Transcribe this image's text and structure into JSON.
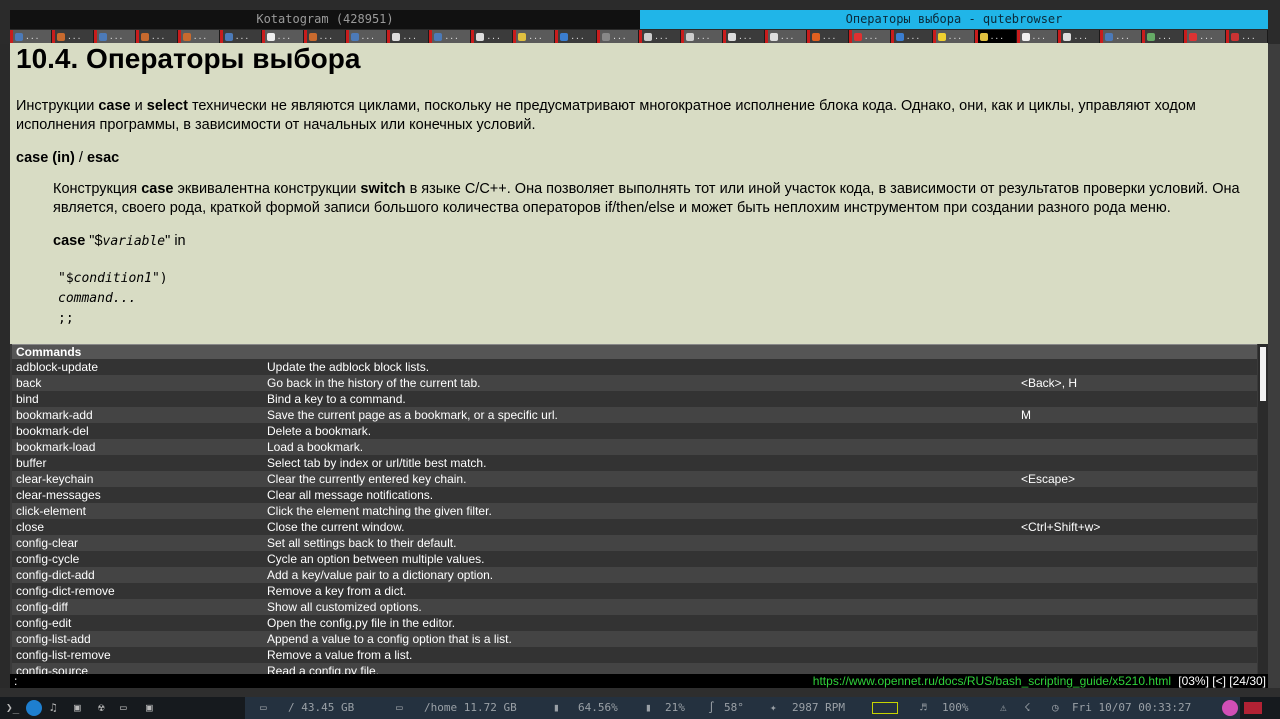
{
  "windows": {
    "kotatogram_title": "Kotatogram (428951)",
    "qute_title": "Операторы выбора - qutebrowser"
  },
  "tabs_count": 30,
  "page": {
    "heading": "10.4. Операторы выбора",
    "intro_a": "Инструкции ",
    "intro_case": "case",
    "intro_and": " и ",
    "intro_select": "select",
    "intro_b": " технически не являются циклами, поскольку не предусматривают многократное исполнение блока кода. Однако, они, как и циклы, управляют ходом исполнения программы, в зависимости от начальных или конечных условий.",
    "case_heading_case": "case (in)",
    "case_heading_slash": " / ",
    "case_heading_esac": "esac",
    "desc_a": "Конструкция ",
    "desc_case": "case",
    "desc_b": " эквивалентна конструкции ",
    "desc_switch": "switch",
    "desc_c": " в языке C/C++. Она позволяет выполнять тот или иной участок кода, в зависимости от результатов проверки условий. Она является, своего рода, краткой формой записи большого количества операторов if/then/else и может быть неплохим инструментом при создании разного рода меню.",
    "syntax_case": "case",
    "syntax_q1": " \"$",
    "syntax_var": "variable",
    "syntax_q2": "\" in",
    "code_q1": "\"$",
    "code_cond": "condition1",
    "code_q2": "\")",
    "code_command": "command...",
    "code_semis": ";;"
  },
  "completion": {
    "header": "Commands",
    "rows": [
      {
        "cmd": "adblock-update",
        "desc": "Update the adblock block lists.",
        "keys": ""
      },
      {
        "cmd": "back",
        "desc": "Go back in the history of the current tab.",
        "keys": "<Back>, H"
      },
      {
        "cmd": "bind",
        "desc": "Bind a key to a command.",
        "keys": ""
      },
      {
        "cmd": "bookmark-add",
        "desc": "Save the current page as a bookmark, or a specific url.",
        "keys": "M"
      },
      {
        "cmd": "bookmark-del",
        "desc": "Delete a bookmark.",
        "keys": ""
      },
      {
        "cmd": "bookmark-load",
        "desc": "Load a bookmark.",
        "keys": ""
      },
      {
        "cmd": "buffer",
        "desc": "Select tab by index or url/title best match.",
        "keys": ""
      },
      {
        "cmd": "clear-keychain",
        "desc": "Clear the currently entered key chain.",
        "keys": "<Escape>"
      },
      {
        "cmd": "clear-messages",
        "desc": "Clear all message notifications.",
        "keys": ""
      },
      {
        "cmd": "click-element",
        "desc": "Click the element matching the given filter.",
        "keys": ""
      },
      {
        "cmd": "close",
        "desc": "Close the current window.",
        "keys": "<Ctrl+Shift+w>"
      },
      {
        "cmd": "config-clear",
        "desc": "Set all settings back to their default.",
        "keys": ""
      },
      {
        "cmd": "config-cycle",
        "desc": "Cycle an option between multiple values.",
        "keys": ""
      },
      {
        "cmd": "config-dict-add",
        "desc": "Add a key/value pair to a dictionary option.",
        "keys": ""
      },
      {
        "cmd": "config-dict-remove",
        "desc": "Remove a key from a dict.",
        "keys": ""
      },
      {
        "cmd": "config-diff",
        "desc": "Show all customized options.",
        "keys": ""
      },
      {
        "cmd": "config-edit",
        "desc": "Open the config.py file in the editor.",
        "keys": ""
      },
      {
        "cmd": "config-list-add",
        "desc": "Append a value to a config option that is a list.",
        "keys": ""
      },
      {
        "cmd": "config-list-remove",
        "desc": "Remove a value from a list.",
        "keys": ""
      },
      {
        "cmd": "config-source",
        "desc": "Read a config.py file.",
        "keys": ""
      }
    ]
  },
  "statusbar": {
    "cmdline": ":",
    "url": "https://www.opennet.ru/docs/RUS/bash_scripting_guide/x5210.html",
    "scroll": "[03%]",
    "history": "[<]",
    "tab_index": "[24/30]"
  },
  "panel": {
    "disk_root": "/ 43.45 GB",
    "disk_home": "/home 11.72 GB",
    "battery_pct": "64.56%",
    "memory": "21%",
    "temp": "58°",
    "fan": "2987 RPM",
    "volume": "100%",
    "clock": "Fri 10/07 00:33:27"
  },
  "colors": {
    "page_bg": "#d8dcc4",
    "active_title": "#20b5e8",
    "url_green": "#2fd13a",
    "tab_indicator": "#c91c1c"
  }
}
